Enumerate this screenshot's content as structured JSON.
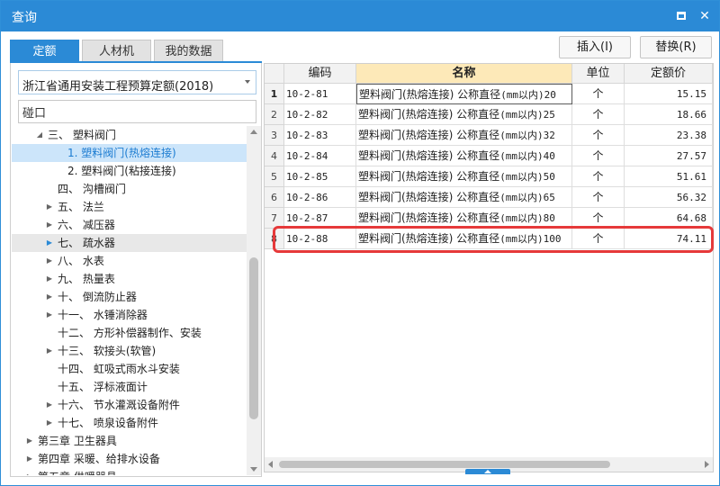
{
  "window": {
    "title": "查询"
  },
  "tabs": [
    {
      "label": "定额",
      "active": true
    },
    {
      "label": "人材机",
      "active": false
    },
    {
      "label": "我的数据",
      "active": false
    }
  ],
  "toolbar": {
    "insert_label": "插入(I)",
    "replace_label": "替换(R)"
  },
  "left": {
    "select_value": "浙江省通用安装工程预算定额(2018)",
    "search_value": "碰口",
    "tree": [
      {
        "label": "三、 塑料阀门",
        "indent": 2,
        "expander": "expanded"
      },
      {
        "label": "1. 塑料阀门(热熔连接)",
        "indent": 4,
        "expander": "none",
        "selected": true
      },
      {
        "label": "2. 塑料阀门(粘接连接)",
        "indent": 4,
        "expander": "none"
      },
      {
        "label": "四、 沟槽阀门",
        "indent": 3,
        "expander": "none"
      },
      {
        "label": "五、 法兰",
        "indent": 3,
        "expander": "collapsed"
      },
      {
        "label": "六、 减压器",
        "indent": 3,
        "expander": "collapsed"
      },
      {
        "label": "七、 疏水器",
        "indent": 3,
        "expander": "collapsed-blue",
        "hover": true
      },
      {
        "label": "八、 水表",
        "indent": 3,
        "expander": "collapsed"
      },
      {
        "label": "九、 热量表",
        "indent": 3,
        "expander": "collapsed"
      },
      {
        "label": "十、 倒流防止器",
        "indent": 3,
        "expander": "collapsed"
      },
      {
        "label": "十一、 水锤消除器",
        "indent": 3,
        "expander": "collapsed"
      },
      {
        "label": "十二、 方形补偿器制作、安装",
        "indent": 3,
        "expander": "none"
      },
      {
        "label": "十三、 软接头(软管)",
        "indent": 3,
        "expander": "collapsed"
      },
      {
        "label": "十四、 虹吸式雨水斗安装",
        "indent": 3,
        "expander": "none"
      },
      {
        "label": "十五、 浮标液面计",
        "indent": 3,
        "expander": "none"
      },
      {
        "label": "十六、 节水灌溉设备附件",
        "indent": 3,
        "expander": "collapsed"
      },
      {
        "label": "十七、 喷泉设备附件",
        "indent": 3,
        "expander": "collapsed"
      },
      {
        "label": "第三章 卫生器具",
        "indent": 1,
        "expander": "collapsed"
      },
      {
        "label": "第四章 采暖、给排水设备",
        "indent": 1,
        "expander": "collapsed"
      },
      {
        "label": "第五章 供暖器具",
        "indent": 1,
        "expander": "collapsed"
      }
    ]
  },
  "grid": {
    "columns": [
      "编码",
      "名称",
      "单位",
      "定额价"
    ],
    "rows": [
      {
        "num": "1",
        "code": "10-2-81",
        "name_prefix": "塑料阀门(热熔连接) 公称直径",
        "name_suffix": "(mm以内)20",
        "unit": "个",
        "price": "15.15"
      },
      {
        "num": "2",
        "code": "10-2-82",
        "name_prefix": "塑料阀门(热熔连接) 公称直径",
        "name_suffix": "(mm以内)25",
        "unit": "个",
        "price": "18.66"
      },
      {
        "num": "3",
        "code": "10-2-83",
        "name_prefix": "塑料阀门(热熔连接) 公称直径",
        "name_suffix": "(mm以内)32",
        "unit": "个",
        "price": "23.38"
      },
      {
        "num": "4",
        "code": "10-2-84",
        "name_prefix": "塑料阀门(热熔连接) 公称直径",
        "name_suffix": "(mm以内)40",
        "unit": "个",
        "price": "27.57"
      },
      {
        "num": "5",
        "code": "10-2-85",
        "name_prefix": "塑料阀门(热熔连接) 公称直径",
        "name_suffix": "(mm以内)50",
        "unit": "个",
        "price": "51.61"
      },
      {
        "num": "6",
        "code": "10-2-86",
        "name_prefix": "塑料阀门(热熔连接) 公称直径",
        "name_suffix": "(mm以内)65",
        "unit": "个",
        "price": "56.32"
      },
      {
        "num": "7",
        "code": "10-2-87",
        "name_prefix": "塑料阀门(热熔连接) 公称直径",
        "name_suffix": "(mm以内)80",
        "unit": "个",
        "price": "64.68"
      },
      {
        "num": "8",
        "code": "10-2-88",
        "name_prefix": "塑料阀门(热熔连接) 公称直径",
        "name_suffix": "(mm以内)100",
        "unit": "个",
        "price": "74.11",
        "highlighted": true
      }
    ]
  },
  "colors": {
    "accent": "#2b8ad6",
    "highlight": "#e6393a",
    "selected_row": "#cce5fa",
    "name_header": "#fde9b8"
  }
}
